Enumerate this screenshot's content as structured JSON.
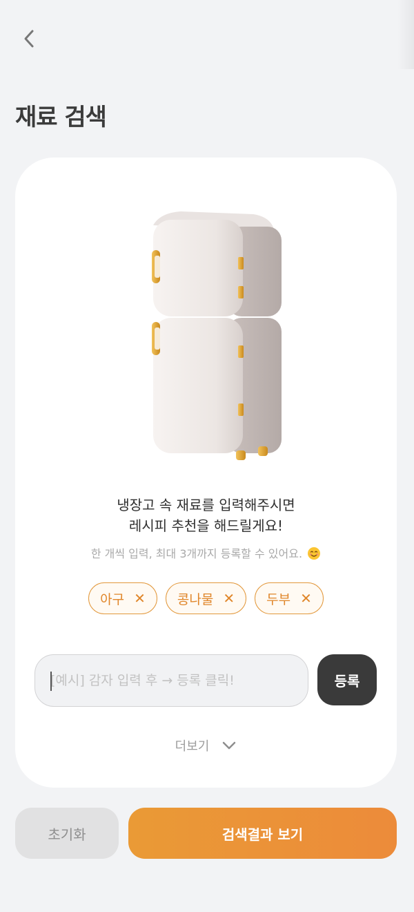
{
  "header": {
    "back_icon": "chevron-left-icon",
    "title": "재료 검색"
  },
  "card": {
    "illustration": "refrigerator",
    "headline_line1": "냉장고 속 재료를 입력해주시면",
    "headline_line2": "레시피 추천을 해드릴게요!",
    "subtext": "한 개씩 입력, 최대 3개까지 등록할 수 있어요.",
    "subtext_emoji": "smiling-face-icon",
    "chips": [
      {
        "label": "아구"
      },
      {
        "label": "콩나물"
      },
      {
        "label": "두부"
      }
    ],
    "chip_remove_symbol": "✕",
    "input": {
      "placeholder": "[예시] 감자 입력 후 → 등록 클릭!",
      "value": ""
    },
    "register_label": "등록",
    "more_label": "더보기"
  },
  "footer": {
    "reset_label": "초기화",
    "search_label": "검색결과 보기"
  },
  "colors": {
    "accent": "#ec8b3a",
    "chip_border": "#e2973a",
    "dark_button": "#3a3a3a",
    "background": "#f2f3f5"
  }
}
